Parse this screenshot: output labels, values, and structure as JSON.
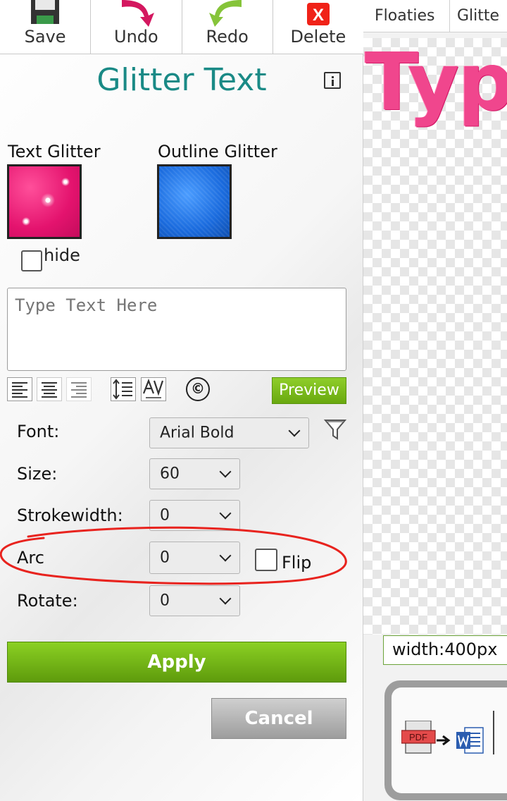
{
  "toolbar": {
    "save_label": "Save",
    "undo_label": "Undo",
    "redo_label": "Redo",
    "delete_label": "Delete",
    "delete_icon_glyph": "X"
  },
  "panel": {
    "title": "Glitter Text",
    "text_glitter_label": "Text Glitter",
    "outline_glitter_label": "Outline Glitter",
    "hide_label": "hide",
    "text_placeholder": "Type Text Here",
    "copyright_glyph": "©",
    "preview_label": "Preview",
    "font_label": "Font:",
    "font_value": "Arial Bold",
    "size_label": "Size:",
    "size_value": "60",
    "strokewidth_label": "Strokewidth:",
    "strokewidth_value": "0",
    "arc_label": "Arc",
    "arc_value": "0",
    "flip_label": "Flip",
    "rotate_label": "Rotate:",
    "rotate_value": "0",
    "apply_label": "Apply",
    "cancel_label": "Cancel"
  },
  "right": {
    "tab_floaties": "Floaties",
    "tab_glitter": "Glitte",
    "canvas_text": "Typ",
    "width_value": "width:400px",
    "promo_pdf_text": "PDF"
  },
  "colors": {
    "title_teal": "#1a8a86",
    "accent_green": "#76b81a",
    "glitter_pink": "#e4136e",
    "glitter_blue": "#1a6bde",
    "annotation_red": "#e8231e"
  }
}
